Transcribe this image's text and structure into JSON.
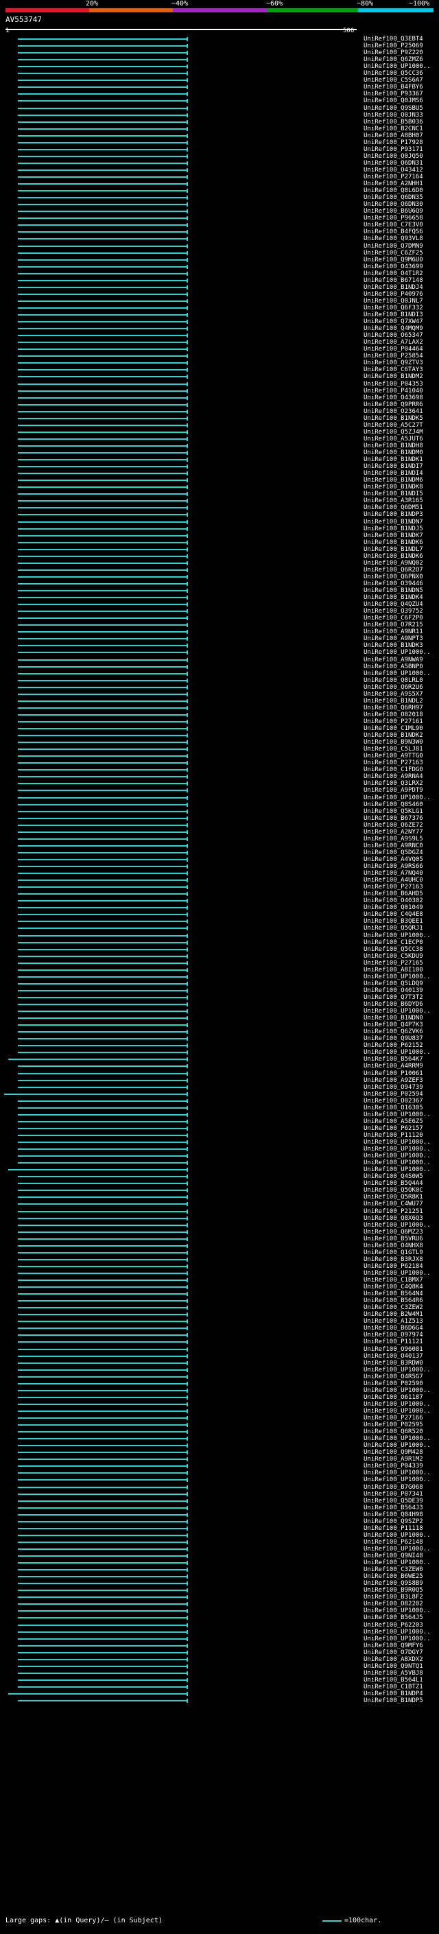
{
  "scale": {
    "labels": [
      "20%",
      "~40%",
      "~60%",
      "~80%",
      "~100%"
    ],
    "colors": [
      "#e0182b",
      "#e06010",
      "#a028c0",
      "#00a010",
      "#00c8e0"
    ]
  },
  "query": {
    "name": "AV553747",
    "start": "1",
    "end": "506"
  },
  "legend": {
    "large_gaps": "Large gaps: ▲(in Query)/— (in Subject)",
    "scale_note": "=100char."
  },
  "hits": [
    "UniRef100_Q3EBT4",
    "UniRef100_P25069",
    "UniRef100_P9Z220",
    "UniRef100_Q6ZMZ6",
    "UniRef100_UP1000..",
    "UniRef100_Q5CC36",
    "UniRef100_C5S6A7",
    "UniRef100_B4FBY6",
    "UniRef100_P93367",
    "UniRef100_Q0JMS6",
    "UniRef100_Q9SBU5",
    "UniRef100_Q0JN33",
    "UniRef100_B5B036",
    "UniRef100_B2CNC1",
    "UniRef100_A8BH07",
    "UniRef100_P17928",
    "UniRef100_P93171",
    "UniRef100_Q0JQ50",
    "UniRef100_Q6DN31",
    "UniRef100_O43412",
    "UniRef100_P27164",
    "UniRef100_A2NHH1",
    "UniRef100_Q8L6D0",
    "UniRef100_Q6DN35",
    "UniRef100_Q6DN30",
    "UniRef100_B6U6Q9",
    "UniRef100_P96658",
    "UniRef100_C7E3V0",
    "UniRef100_B4FQS6",
    "UniRef100_Q93VL8",
    "UniRef100_Q7DMN9",
    "UniRef100_C6ZF25",
    "UniRef100_Q9M6U0",
    "UniRef100_O43699",
    "UniRef100_O4T1R2",
    "UniRef100_B67148",
    "UniRef100_B1NDJ4",
    "UniRef100_P40976",
    "UniRef100_Q0JNL7",
    "UniRef100_Q6F332",
    "UniRef100_B1NDI3",
    "UniRef100_Q7XW47",
    "UniRef100_Q4MQM9",
    "UniRef100_O65347",
    "UniRef100_A7LAX2",
    "UniRef100_P04464",
    "UniRef100_P25854",
    "UniRef100_Q9ZTV3",
    "UniRef100_C6TAY3",
    "UniRef100_B1NDM2",
    "UniRef100_P04353",
    "UniRef100_P41040",
    "UniRef100_O43698",
    "UniRef100_Q9PRR6",
    "UniRef100_O23641",
    "UniRef100_B1NDK5",
    "UniRef100_A5C27T",
    "UniRef100_Q5ZJ4M",
    "UniRef100_A5JUT6",
    "UniRef100_B1NDH8",
    "UniRef100_B1NDM0",
    "UniRef100_B1NDK1",
    "UniRef100_B1NDI7",
    "UniRef100_B1NDI4",
    "UniRef100_B1NDM6",
    "UniRef100_B1NDK8",
    "UniRef100_B1NDI5",
    "UniRef100_A3R165",
    "UniRef100_Q6DM51",
    "UniRef100_B1NDP3",
    "UniRef100_B1NDN7",
    "UniRef100_B1NDJ5",
    "UniRef100_B1NDK7",
    "UniRef100_B1NDK6",
    "UniRef100_B1NDL7",
    "UniRef100_B1NDK6",
    "UniRef100_A9NQ02",
    "UniRef100_Q6R2O7",
    "UniRef100_Q6PNX0",
    "UniRef100_O39446",
    "UniRef100_B1NDN5",
    "UniRef100_B1NDK4",
    "UniRef100_Q4QZU4",
    "UniRef100_Q39752",
    "UniRef100_C6F2P0",
    "UniRef100_O7R215",
    "UniRef100_A9NR11",
    "UniRef100_A9NPT3",
    "UniRef100_B1NDK3",
    "UniRef100_UP1000..",
    "UniRef100_A9NWA9",
    "UniRef100_A5BNP0",
    "UniRef100_UP1000..",
    "UniRef100_Q8LRL0",
    "UniRef100_Q6R2U6",
    "UniRef100_A9S5X7",
    "UniRef100_B1NDL2",
    "UniRef100_Q6RH97",
    "UniRef100_O82018",
    "UniRef100_P27161",
    "UniRef100_C1ML90",
    "UniRef100_B1NDK2",
    "UniRef100_B9N3W0",
    "UniRef100_C5LJ81",
    "UniRef100_A9TTG0",
    "UniRef100_P27163",
    "UniRef100_C1FDG0",
    "UniRef100_A9RNA4",
    "UniRef100_Q3LRX2",
    "UniRef100_A9PDT9",
    "UniRef100_UP1000..",
    "UniRef100_Q8S460",
    "UniRef100_Q5KLG1",
    "UniRef100_B67376",
    "UniRef100_Q6ZE72",
    "UniRef100_A2NY77",
    "UniRef100_A9S9L5",
    "UniRef100_A9RNC0",
    "UniRef100_Q5DGZ4",
    "UniRef100_A4VQ05",
    "UniRef100_A9RS66",
    "UniRef100_A7NQ40",
    "UniRef100_A4UHC0",
    "UniRef100_P27163",
    "UniRef100_B6AHD5",
    "UniRef100_O40302",
    "UniRef100_Q01049",
    "UniRef100_C4Q4E8",
    "UniRef100_B3QEE1",
    "UniRef100_Q5QRJ1",
    "UniRef100_UP1000..",
    "UniRef100_C1ECP0",
    "UniRef100_Q5CC38",
    "UniRef100_C5KDU9",
    "UniRef100_P27165",
    "UniRef100_A8I100",
    "UniRef100_UP1000..",
    "UniRef100_Q5LDQ9",
    "UniRef100_O40139",
    "UniRef100_Q7T3T2",
    "UniRef100_B6DYD6",
    "UniRef100_UP1000..",
    "UniRef100_B1NDN0",
    "UniRef100_Q4P7K3",
    "UniRef100_Q6ZVK6",
    "UniRef100_Q9U837",
    "UniRef100_P62152",
    "UniRef100_UP1000..",
    "UniRef100_B564K7",
    "UniRef100_A4RRM9",
    "UniRef100_P10061",
    "UniRef100_A9ZEF3",
    "UniRef100_O94739",
    "UniRef100_P02594",
    "UniRef100_O02367",
    "UniRef100_O16305",
    "UniRef100_UP1000..",
    "UniRef100_A5E6Z5",
    "UniRef100_P62157",
    "UniRef100_P11120",
    "UniRef100_UP1000..",
    "UniRef100_UP1000..",
    "UniRef100_UP1000..",
    "UniRef100_UP1000..",
    "UniRef100_UP1000..",
    "UniRef100_Q4S0W5",
    "UniRef100_B5Q4A4",
    "UniRef100_Q5OK0C",
    "UniRef100_Q5R8K1",
    "UniRef100_C4WU77",
    "UniRef100_P21251",
    "UniRef100_Q8X6Q3",
    "UniRef100_UP1000..",
    "UniRef100_Q6MZ23",
    "UniRef100_B5VRU6",
    "UniRef100_O4NHX8",
    "UniRef100_Q1GTL9",
    "UniRef100_B3RJX8",
    "UniRef100_P62184",
    "UniRef100_UP1000..",
    "UniRef100_C1BMX7",
    "UniRef100_C4Q8K4",
    "UniRef100_B564N4",
    "UniRef100_B564R6",
    "UniRef100_C3ZEW2",
    "UniRef100_B2W4M1",
    "UniRef100_A1Z513",
    "UniRef100_B6D6G4",
    "UniRef100_O97974",
    "UniRef100_P11121",
    "UniRef100_O96081",
    "UniRef100_O40137",
    "UniRef100_B3RDW0",
    "UniRef100_UP1000..",
    "UniRef100_O4R5G7",
    "UniRef100_P02590",
    "UniRef100_UP1000..",
    "UniRef100_O61187",
    "UniRef100_UP1000..",
    "UniRef100_UP1000..",
    "UniRef100_P27166",
    "UniRef100_P02595",
    "UniRef100_Q6R520",
    "UniRef100_UP1000..",
    "UniRef100_UP1000..",
    "UniRef100_Q9M428",
    "UniRef100_A9R1M2",
    "UniRef100_P04339",
    "UniRef100_UP1000..",
    "UniRef100_UP1000..",
    "UniRef100_B7G068",
    "UniRef100_P07341",
    "UniRef100_Q5DE39",
    "UniRef100_B564J3",
    "UniRef100_Q04H98",
    "UniRef100_Q9SZP2",
    "UniRef100_P11118",
    "UniRef100_UP1000..",
    "UniRef100_P62148",
    "UniRef100_UP1000..",
    "UniRef100_Q9NI48",
    "UniRef100_UP1000..",
    "UniRef100_C3ZEW0",
    "UniRef100_B6WE25",
    "UniRef100_Q9S8B9",
    "UniRef100_B9R0Q5",
    "UniRef100_B3L8F2",
    "UniRef100_O82202",
    "UniRef100_UP1000..",
    "UniRef100_B564J5",
    "UniRef100_P62203",
    "UniRef100_UP1000..",
    "UniRef100_UP1000..",
    "UniRef100_Q9MFY6",
    "UniRef100_O7DGY7",
    "UniRef100_A8XDX2",
    "UniRef100_Q9NTQ1",
    "UniRef100_A5VBJ8",
    "UniRef100_B564L1",
    "UniRef100_C1BTZ1",
    "UniRef100_B1NDP4",
    "UniRef100_B1NDP5"
  ]
}
